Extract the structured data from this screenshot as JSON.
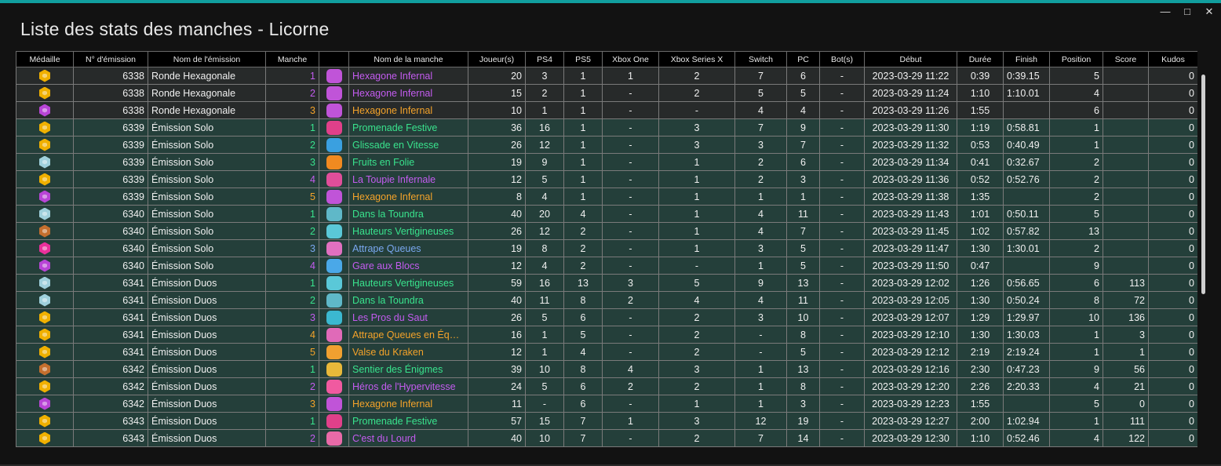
{
  "window": {
    "title": "Liste des stats des manches - Licorne",
    "accent": "#119e9e",
    "controls": [
      "minimize-icon",
      "maximize-icon",
      "close-icon"
    ]
  },
  "colors": {
    "gold": "#f0b000",
    "silver": "#9fd0dc",
    "bronze": "#c46f2e",
    "pink": "#e8309a",
    "eliminated": "#b845d6",
    "row_green": "#243f3a",
    "row_dark": "#272a2a",
    "round_green": "#39e38d",
    "round_purple": "#c45cf0",
    "round_orange": "#f4a32a",
    "round_blue": "#7aa8f0"
  },
  "columns": [
    "Médaille",
    "N° d'émission",
    "Nom de l'émission",
    "Manche",
    "",
    "Nom de la manche",
    "Joueur(s)",
    "PS4",
    "PS5",
    "Xbox One",
    "Xbox Series X",
    "Switch",
    "PC",
    "Bot(s)",
    "Début",
    "Durée",
    "Finish",
    "Position",
    "Score",
    "Kudos"
  ],
  "rows": [
    {
      "medal": "gold",
      "show": "6338",
      "show_name": "Ronde Hexagonale",
      "round": "1",
      "round_name": "Hexagone Infernal",
      "round_color": "purple",
      "icon": "hexagone-infernal-icon",
      "players": "20",
      "ps4": "3",
      "ps5": "1",
      "xone": "1",
      "xsx": "2",
      "switch": "7",
      "pc": "6",
      "bots": "-",
      "start": "2023-03-29 11:22",
      "duration": "0:39",
      "finish": "0:39.15",
      "position": "5",
      "score": "",
      "kudos": "0",
      "bg": "dk"
    },
    {
      "medal": "gold",
      "show": "6338",
      "show_name": "Ronde Hexagonale",
      "round": "2",
      "round_name": "Hexagone Infernal",
      "round_color": "purple",
      "icon": "hexagone-infernal-icon",
      "players": "15",
      "ps4": "2",
      "ps5": "1",
      "xone": "-",
      "xsx": "2",
      "switch": "5",
      "pc": "5",
      "bots": "-",
      "start": "2023-03-29 11:24",
      "duration": "1:10",
      "finish": "1:10.01",
      "position": "4",
      "score": "",
      "kudos": "0",
      "bg": "dk"
    },
    {
      "medal": "eliminated",
      "show": "6338",
      "show_name": "Ronde Hexagonale",
      "round": "3",
      "round_name": "Hexagone Infernal",
      "round_color": "orange",
      "icon": "hexagone-infernal-icon",
      "players": "10",
      "ps4": "1",
      "ps5": "1",
      "xone": "-",
      "xsx": "-",
      "switch": "4",
      "pc": "4",
      "bots": "-",
      "start": "2023-03-29 11:26",
      "duration": "1:55",
      "finish": "",
      "position": "6",
      "score": "",
      "kudos": "0",
      "bg": "dk"
    },
    {
      "medal": "gold",
      "show": "6339",
      "show_name": "Émission Solo",
      "round": "1",
      "round_name": "Promenade Festive",
      "round_color": "green",
      "icon": "promenade-festive-icon",
      "players": "36",
      "ps4": "16",
      "ps5": "1",
      "xone": "-",
      "xsx": "3",
      "switch": "7",
      "pc": "9",
      "bots": "-",
      "start": "2023-03-29 11:30",
      "duration": "1:19",
      "finish": "0:58.81",
      "position": "1",
      "score": "",
      "kudos": "0",
      "bg": "gr"
    },
    {
      "medal": "gold",
      "show": "6339",
      "show_name": "Émission Solo",
      "round": "2",
      "round_name": "Glissade en Vitesse",
      "round_color": "green",
      "icon": "glissade-en-vitesse-icon",
      "players": "26",
      "ps4": "12",
      "ps5": "1",
      "xone": "-",
      "xsx": "3",
      "switch": "3",
      "pc": "7",
      "bots": "-",
      "start": "2023-03-29 11:32",
      "duration": "0:53",
      "finish": "0:40.49",
      "position": "1",
      "score": "",
      "kudos": "0",
      "bg": "gr"
    },
    {
      "medal": "silver",
      "show": "6339",
      "show_name": "Émission Solo",
      "round": "3",
      "round_name": "Fruits en Folie",
      "round_color": "green",
      "icon": "fruits-en-folie-icon",
      "players": "19",
      "ps4": "9",
      "ps5": "1",
      "xone": "-",
      "xsx": "1",
      "switch": "2",
      "pc": "6",
      "bots": "-",
      "start": "2023-03-29 11:34",
      "duration": "0:41",
      "finish": "0:32.67",
      "position": "2",
      "score": "",
      "kudos": "0",
      "bg": "gr"
    },
    {
      "medal": "gold",
      "show": "6339",
      "show_name": "Émission Solo",
      "round": "4",
      "round_name": "La Toupie Infernale",
      "round_color": "purple",
      "icon": "toupie-infernale-icon",
      "players": "12",
      "ps4": "5",
      "ps5": "1",
      "xone": "-",
      "xsx": "1",
      "switch": "2",
      "pc": "3",
      "bots": "-",
      "start": "2023-03-29 11:36",
      "duration": "0:52",
      "finish": "0:52.76",
      "position": "2",
      "score": "",
      "kudos": "0",
      "bg": "gr"
    },
    {
      "medal": "eliminated",
      "show": "6339",
      "show_name": "Émission Solo",
      "round": "5",
      "round_name": "Hexagone Infernal",
      "round_color": "orange",
      "icon": "hexagone-infernal-icon",
      "players": "8",
      "ps4": "4",
      "ps5": "1",
      "xone": "-",
      "xsx": "1",
      "switch": "1",
      "pc": "1",
      "bots": "-",
      "start": "2023-03-29 11:38",
      "duration": "1:35",
      "finish": "",
      "position": "2",
      "score": "",
      "kudos": "0",
      "bg": "gr"
    },
    {
      "medal": "silver",
      "show": "6340",
      "show_name": "Émission Solo",
      "round": "1",
      "round_name": "Dans la Toundra",
      "round_color": "green",
      "icon": "dans-la-toundra-icon",
      "players": "40",
      "ps4": "20",
      "ps5": "4",
      "xone": "-",
      "xsx": "1",
      "switch": "4",
      "pc": "11",
      "bots": "-",
      "start": "2023-03-29 11:43",
      "duration": "1:01",
      "finish": "0:50.11",
      "position": "5",
      "score": "",
      "kudos": "0",
      "bg": "gr"
    },
    {
      "medal": "bronze",
      "show": "6340",
      "show_name": "Émission Solo",
      "round": "2",
      "round_name": "Hauteurs Vertigineuses",
      "round_color": "green",
      "icon": "hauteurs-vertigineuses-icon",
      "players": "26",
      "ps4": "12",
      "ps5": "2",
      "xone": "-",
      "xsx": "1",
      "switch": "4",
      "pc": "7",
      "bots": "-",
      "start": "2023-03-29 11:45",
      "duration": "1:02",
      "finish": "0:57.82",
      "position": "13",
      "score": "",
      "kudos": "0",
      "bg": "gr"
    },
    {
      "medal": "pink",
      "show": "6340",
      "show_name": "Émission Solo",
      "round": "3",
      "round_name": "Attrape Queues",
      "round_color": "blue",
      "icon": "attrape-queues-icon",
      "players": "19",
      "ps4": "8",
      "ps5": "2",
      "xone": "-",
      "xsx": "1",
      "switch": "3",
      "pc": "5",
      "bots": "-",
      "start": "2023-03-29 11:47",
      "duration": "1:30",
      "finish": "1:30.01",
      "position": "2",
      "score": "",
      "kudos": "0",
      "bg": "gr"
    },
    {
      "medal": "eliminated",
      "show": "6340",
      "show_name": "Émission Solo",
      "round": "4",
      "round_name": "Gare aux Blocs",
      "round_color": "purple",
      "icon": "gare-aux-blocs-icon",
      "players": "12",
      "ps4": "4",
      "ps5": "2",
      "xone": "-",
      "xsx": "-",
      "switch": "1",
      "pc": "5",
      "bots": "-",
      "start": "2023-03-29 11:50",
      "duration": "0:47",
      "finish": "",
      "position": "9",
      "score": "",
      "kudos": "0",
      "bg": "gr"
    },
    {
      "medal": "silver",
      "show": "6341",
      "show_name": "Émission Duos",
      "round": "1",
      "round_name": "Hauteurs Vertigineuses",
      "round_color": "green",
      "icon": "hauteurs-vertigineuses-icon",
      "players": "59",
      "ps4": "16",
      "ps5": "13",
      "xone": "3",
      "xsx": "5",
      "switch": "9",
      "pc": "13",
      "bots": "-",
      "start": "2023-03-29 12:02",
      "duration": "1:26",
      "finish": "0:56.65",
      "position": "6",
      "score": "113",
      "kudos": "0",
      "bg": "gr"
    },
    {
      "medal": "silver",
      "show": "6341",
      "show_name": "Émission Duos",
      "round": "2",
      "round_name": "Dans la Toundra",
      "round_color": "green",
      "icon": "dans-la-toundra-icon",
      "players": "40",
      "ps4": "11",
      "ps5": "8",
      "xone": "2",
      "xsx": "4",
      "switch": "4",
      "pc": "11",
      "bots": "-",
      "start": "2023-03-29 12:05",
      "duration": "1:30",
      "finish": "0:50.24",
      "position": "8",
      "score": "72",
      "kudos": "0",
      "bg": "gr"
    },
    {
      "medal": "gold",
      "show": "6341",
      "show_name": "Émission Duos",
      "round": "3",
      "round_name": "Les Pros du Saut",
      "round_color": "purple",
      "icon": "pros-du-saut-icon",
      "players": "26",
      "ps4": "5",
      "ps5": "6",
      "xone": "-",
      "xsx": "2",
      "switch": "3",
      "pc": "10",
      "bots": "-",
      "start": "2023-03-29 12:07",
      "duration": "1:29",
      "finish": "1:29.97",
      "position": "10",
      "score": "136",
      "kudos": "0",
      "bg": "gr"
    },
    {
      "medal": "gold",
      "show": "6341",
      "show_name": "Émission Duos",
      "round": "4",
      "round_name": "Attrape Queues en Équi…",
      "round_color": "orange",
      "icon": "attrape-queues-equipe-icon",
      "players": "16",
      "ps4": "1",
      "ps5": "5",
      "xone": "-",
      "xsx": "2",
      "switch": "-",
      "pc": "8",
      "bots": "-",
      "start": "2023-03-29 12:10",
      "duration": "1:30",
      "finish": "1:30.03",
      "position": "1",
      "score": "3",
      "kudos": "0",
      "bg": "gr"
    },
    {
      "medal": "gold",
      "show": "6341",
      "show_name": "Émission Duos",
      "round": "5",
      "round_name": "Valse du Kraken",
      "round_color": "orange",
      "icon": "valse-du-kraken-icon",
      "players": "12",
      "ps4": "1",
      "ps5": "4",
      "xone": "-",
      "xsx": "2",
      "switch": "-",
      "pc": "5",
      "bots": "-",
      "start": "2023-03-29 12:12",
      "duration": "2:19",
      "finish": "2:19.24",
      "position": "1",
      "score": "1",
      "kudos": "0",
      "bg": "gr"
    },
    {
      "medal": "bronze",
      "show": "6342",
      "show_name": "Émission Duos",
      "round": "1",
      "round_name": "Sentier des Énigmes",
      "round_color": "green",
      "icon": "sentier-des-enigmes-icon",
      "players": "39",
      "ps4": "10",
      "ps5": "8",
      "xone": "4",
      "xsx": "3",
      "switch": "1",
      "pc": "13",
      "bots": "-",
      "start": "2023-03-29 12:16",
      "duration": "2:30",
      "finish": "0:47.23",
      "position": "9",
      "score": "56",
      "kudos": "0",
      "bg": "gr"
    },
    {
      "medal": "gold",
      "show": "6342",
      "show_name": "Émission Duos",
      "round": "2",
      "round_name": "Héros de l'Hypervitesse",
      "round_color": "purple",
      "icon": "heros-hypervitesse-icon",
      "players": "24",
      "ps4": "5",
      "ps5": "6",
      "xone": "2",
      "xsx": "2",
      "switch": "1",
      "pc": "8",
      "bots": "-",
      "start": "2023-03-29 12:20",
      "duration": "2:26",
      "finish": "2:20.33",
      "position": "4",
      "score": "21",
      "kudos": "0",
      "bg": "gr"
    },
    {
      "medal": "eliminated",
      "show": "6342",
      "show_name": "Émission Duos",
      "round": "3",
      "round_name": "Hexagone Infernal",
      "round_color": "orange",
      "icon": "hexagone-infernal-icon",
      "players": "11",
      "ps4": "-",
      "ps5": "6",
      "xone": "-",
      "xsx": "1",
      "switch": "1",
      "pc": "3",
      "bots": "-",
      "start": "2023-03-29 12:23",
      "duration": "1:55",
      "finish": "",
      "position": "5",
      "score": "0",
      "kudos": "0",
      "bg": "gr"
    },
    {
      "medal": "gold",
      "show": "6343",
      "show_name": "Émission Duos",
      "round": "1",
      "round_name": "Promenade Festive",
      "round_color": "green",
      "icon": "promenade-festive-icon",
      "players": "57",
      "ps4": "15",
      "ps5": "7",
      "xone": "1",
      "xsx": "3",
      "switch": "12",
      "pc": "19",
      "bots": "-",
      "start": "2023-03-29 12:27",
      "duration": "2:00",
      "finish": "1:02.94",
      "position": "1",
      "score": "111",
      "kudos": "0",
      "bg": "gr"
    },
    {
      "medal": "gold",
      "show": "6343",
      "show_name": "Émission Duos",
      "round": "2",
      "round_name": "C'est du Lourd",
      "round_color": "purple",
      "icon": "cest-du-lourd-icon",
      "players": "40",
      "ps4": "10",
      "ps5": "7",
      "xone": "-",
      "xsx": "2",
      "switch": "7",
      "pc": "14",
      "bots": "-",
      "start": "2023-03-29 12:30",
      "duration": "1:10",
      "finish": "0:52.46",
      "position": "4",
      "score": "122",
      "kudos": "0",
      "bg": "gr"
    }
  ]
}
